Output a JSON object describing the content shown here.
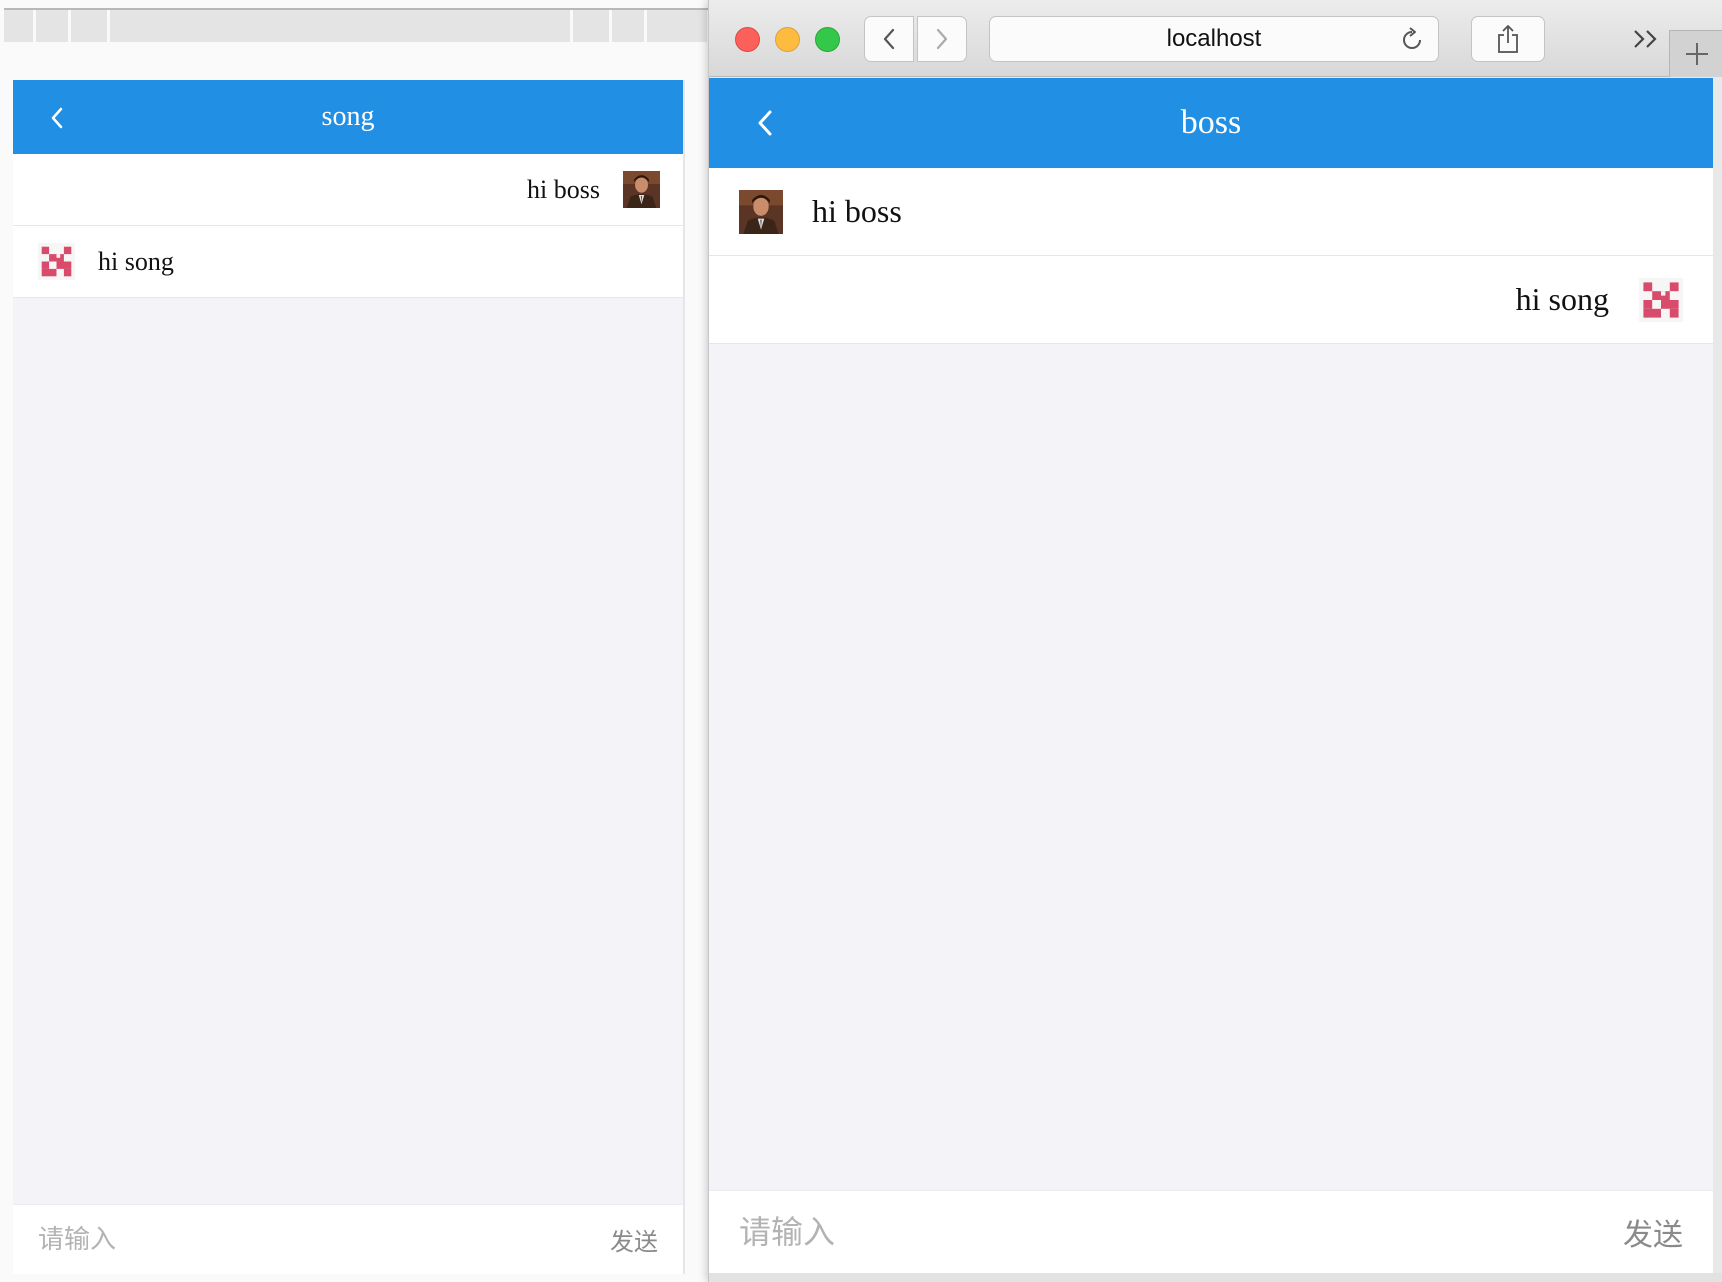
{
  "left_window": {
    "chat": {
      "title": "song",
      "messages": [
        {
          "text": "hi boss",
          "side": "right",
          "avatar": "boss-photo"
        },
        {
          "text": "hi song",
          "side": "left",
          "avatar": "song-pixel"
        }
      ],
      "input_placeholder": "请输入",
      "send_label": "发送"
    }
  },
  "right_window": {
    "address": "localhost",
    "chat": {
      "title": "boss",
      "messages": [
        {
          "text": "hi boss",
          "side": "left",
          "avatar": "boss-photo"
        },
        {
          "text": "hi song",
          "side": "right",
          "avatar": "song-pixel"
        }
      ],
      "input_placeholder": "请输入",
      "send_label": "发送"
    }
  },
  "colors": {
    "navbar": "#2190e4",
    "page_background": "#f4f4f8",
    "pixel_avatar": "#d84b6b"
  }
}
